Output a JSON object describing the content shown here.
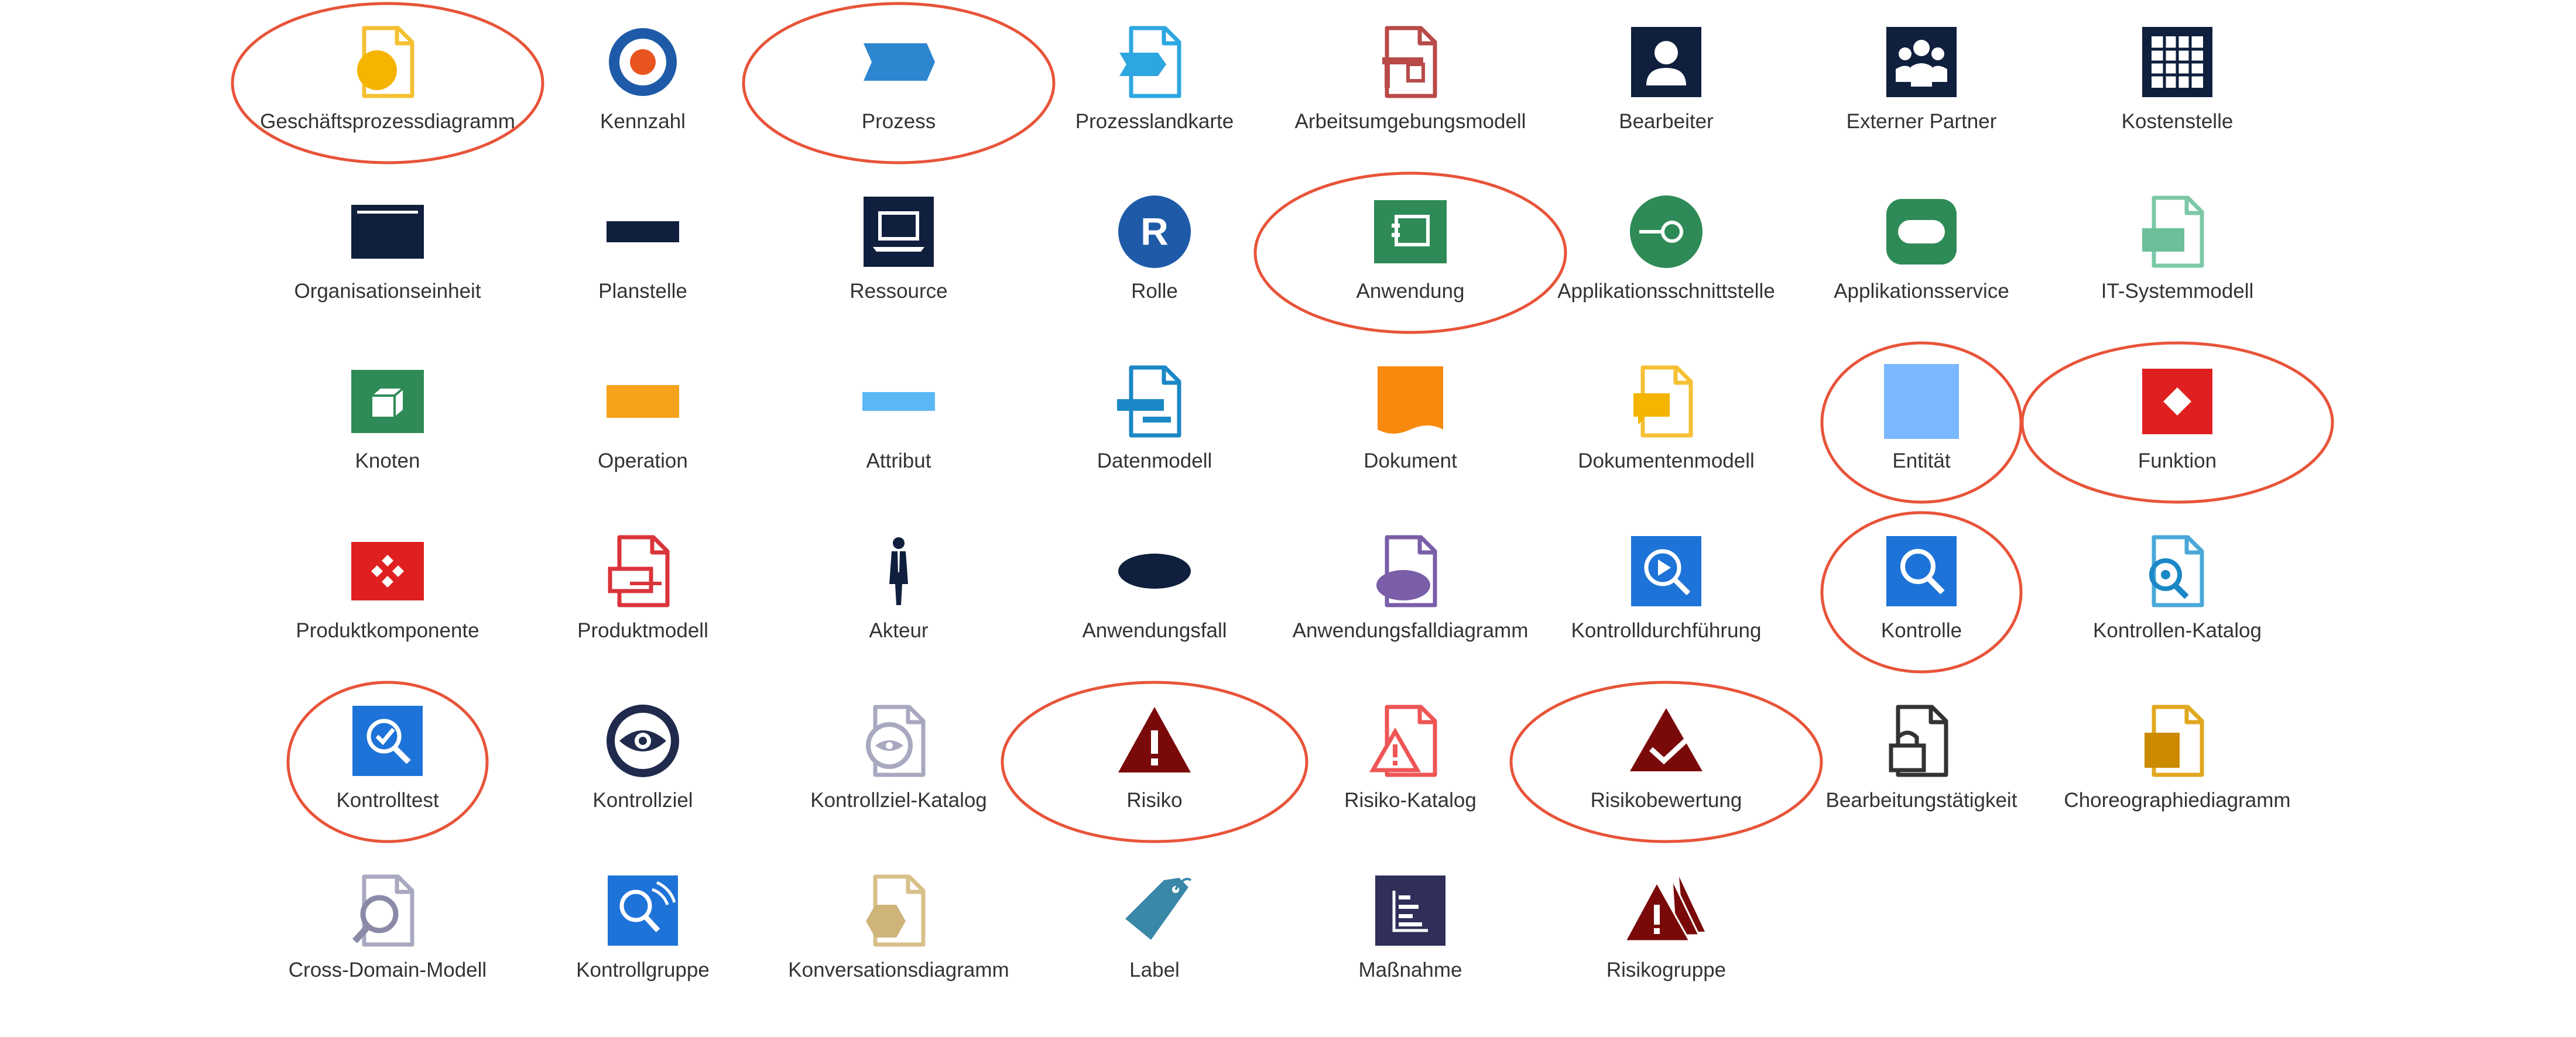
{
  "accent_colors": {
    "highlight_ring": "#e8543a",
    "navy": "#0f1f3d",
    "blue": "#1e73d8",
    "green": "#2e8b57",
    "orange": "#f7a21b",
    "red": "#e02020",
    "dark_red": "#7a0a0a"
  },
  "grid": {
    "rows": [
      [
        {
          "label": "Geschäftsprozessdiagramm",
          "icon": "document-yellow-circle-icon",
          "highlighted": true
        },
        {
          "label": "Kennzahl",
          "icon": "target-icon",
          "highlighted": false
        },
        {
          "label": "Prozess",
          "icon": "process-chevron-icon",
          "highlighted": true
        },
        {
          "label": "Prozesslandkarte",
          "icon": "document-chevron-icon",
          "highlighted": false
        },
        {
          "label": "Arbeitsumgebungsmodell",
          "icon": "document-desk-icon",
          "highlighted": false
        },
        {
          "label": "Bearbeiter",
          "icon": "person-icon",
          "highlighted": false
        },
        {
          "label": "Externer Partner",
          "icon": "group-icon",
          "highlighted": false
        },
        {
          "label": "Kostenstelle",
          "icon": "grid-table-icon",
          "highlighted": false
        }
      ],
      [
        {
          "label": "Organisationseinheit",
          "icon": "org-unit-icon",
          "highlighted": false
        },
        {
          "label": "Planstelle",
          "icon": "position-bar-icon",
          "highlighted": false
        },
        {
          "label": "Ressource",
          "icon": "laptop-icon",
          "highlighted": false
        },
        {
          "label": "Rolle",
          "icon": "role-r-icon",
          "highlighted": false
        },
        {
          "label": "Anwendung",
          "icon": "application-icon",
          "highlighted": true
        },
        {
          "label": "Applikationsschnittstelle",
          "icon": "interface-icon",
          "highlighted": false
        },
        {
          "label": "Applikationsservice",
          "icon": "app-service-icon",
          "highlighted": false
        },
        {
          "label": "IT-Systemmodell",
          "icon": "document-green-icon",
          "highlighted": false
        }
      ],
      [
        {
          "label": "Knoten",
          "icon": "node-cube-icon",
          "highlighted": false
        },
        {
          "label": "Operation",
          "icon": "operation-bar-icon",
          "highlighted": false
        },
        {
          "label": "Attribut",
          "icon": "attribute-bar-icon",
          "highlighted": false
        },
        {
          "label": "Datenmodell",
          "icon": "document-data-icon",
          "highlighted": false
        },
        {
          "label": "Dokument",
          "icon": "document-orange-icon",
          "highlighted": false
        },
        {
          "label": "Dokumentenmodell",
          "icon": "document-model-icon",
          "highlighted": false
        },
        {
          "label": "Entität",
          "icon": "entity-square-icon",
          "highlighted": true
        },
        {
          "label": "Funktion",
          "icon": "function-diamond-icon",
          "highlighted": true
        }
      ],
      [
        {
          "label": "Produktkomponente",
          "icon": "product-component-icon",
          "highlighted": false
        },
        {
          "label": "Produktmodell",
          "icon": "document-product-icon",
          "highlighted": false
        },
        {
          "label": "Akteur",
          "icon": "actor-icon",
          "highlighted": false
        },
        {
          "label": "Anwendungsfall",
          "icon": "use-case-ellipse-icon",
          "highlighted": false
        },
        {
          "label": "Anwendungsfalldiagramm",
          "icon": "document-use-case-icon",
          "highlighted": false
        },
        {
          "label": "Kontrolldurchführung",
          "icon": "control-execution-icon",
          "highlighted": false
        },
        {
          "label": "Kontrolle",
          "icon": "control-search-icon",
          "highlighted": true
        },
        {
          "label": "Kontrollen-Katalog",
          "icon": "document-search-icon",
          "highlighted": false
        }
      ],
      [
        {
          "label": "Kontrolltest",
          "icon": "control-test-icon",
          "highlighted": true
        },
        {
          "label": "Kontrollziel",
          "icon": "eye-icon",
          "highlighted": false
        },
        {
          "label": "Kontrollziel-Katalog",
          "icon": "document-eye-icon",
          "highlighted": false
        },
        {
          "label": "Risiko",
          "icon": "risk-warning-icon",
          "highlighted": true
        },
        {
          "label": "Risiko-Katalog",
          "icon": "document-warning-icon",
          "highlighted": false
        },
        {
          "label": "Risikobewertung",
          "icon": "risk-assessment-icon",
          "highlighted": true
        },
        {
          "label": "Bearbeitungstätigkeit",
          "icon": "document-lock-icon",
          "highlighted": false
        },
        {
          "label": "Choreographiediagramm",
          "icon": "document-choreography-icon",
          "highlighted": false
        }
      ],
      [
        {
          "label": "Cross-Domain-Modell",
          "icon": "document-magnifier-icon",
          "highlighted": false
        },
        {
          "label": "Kontrollgruppe",
          "icon": "control-group-icon",
          "highlighted": false
        },
        {
          "label": "Konversationsdiagramm",
          "icon": "document-hexagon-icon",
          "highlighted": false
        },
        {
          "label": "Label",
          "icon": "tag-icon",
          "highlighted": false
        },
        {
          "label": "Maßnahme",
          "icon": "measure-icon",
          "highlighted": false
        },
        {
          "label": "Risikogruppe",
          "icon": "risk-group-icon",
          "highlighted": false
        }
      ]
    ]
  }
}
